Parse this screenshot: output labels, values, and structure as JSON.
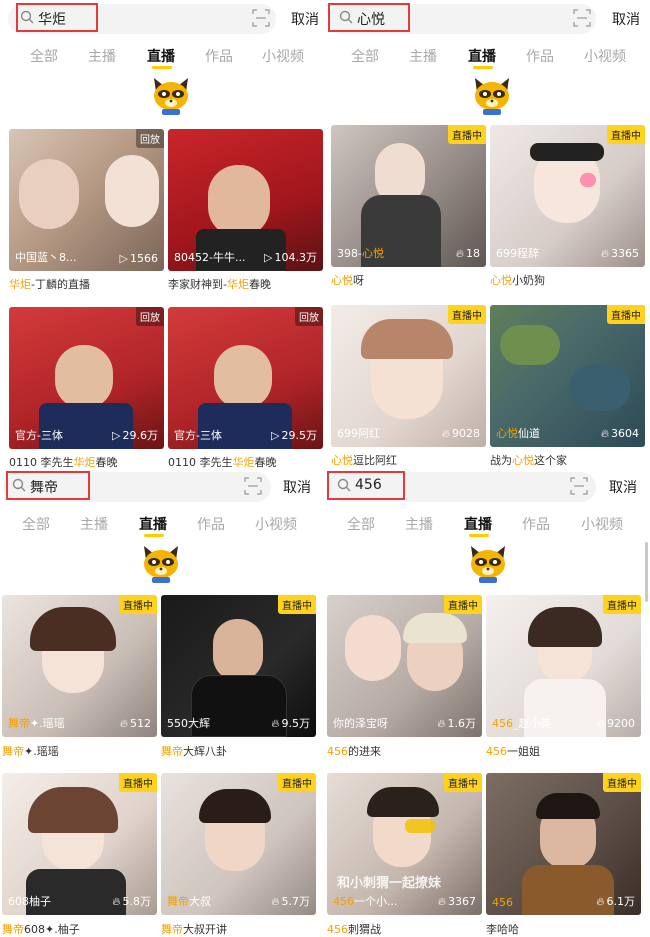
{
  "colors": {
    "accent": "#ffcc00",
    "highlight": "#f5a100",
    "search_outline": "#e23b3b"
  },
  "cancel_label": "取消",
  "tabs": [
    "全部",
    "主播",
    "直播",
    "作品",
    "小视频"
  ],
  "active_tab": "直播",
  "panels": [
    {
      "query": "华炬",
      "cards": [
        {
          "badge": "回放",
          "badge_type": "replay",
          "left": "中国蓝丶8...",
          "right": "1566",
          "right_icon": "play-icon",
          "cap_hl": "华炬",
          "cap_pre": "",
          "cap_post": "-丁麟的直播"
        },
        {
          "badge": "",
          "badge_type": "",
          "left": "80452-牛牛...",
          "right": "104.3万",
          "right_icon": "play-icon",
          "cap_pre": "李家财神到-",
          "cap_hl": "华炬",
          "cap_post": "春晚"
        },
        {
          "badge": "回放",
          "badge_type": "replay",
          "left": "官方-三体",
          "right": "29.6万",
          "right_icon": "play-icon",
          "cap_pre": "0110 李先生",
          "cap_hl": "华炬",
          "cap_post": "春晚"
        },
        {
          "badge": "回放",
          "badge_type": "replay",
          "left": "官方-三体",
          "right": "29.5万",
          "right_icon": "play-icon",
          "cap_pre": "0110 李先生",
          "cap_hl": "华炬",
          "cap_post": "春晚"
        }
      ]
    },
    {
      "query": "心悦",
      "cards": [
        {
          "badge": "直播中",
          "badge_type": "live",
          "left_pre": "398-",
          "left_hl": "心悦",
          "right": "18",
          "right_icon": "flame-icon",
          "cap_pre": "",
          "cap_hl": "心悦",
          "cap_post": "呀"
        },
        {
          "badge": "直播中",
          "badge_type": "live",
          "left_pre": "699程辞",
          "left_hl": "",
          "right": "3365",
          "right_icon": "flame-icon",
          "cap_pre": "",
          "cap_hl": "心悦",
          "cap_post": "小奶狗"
        },
        {
          "badge": "直播中",
          "badge_type": "live",
          "left_pre": "699阿红",
          "left_hl": "",
          "right": "9028",
          "right_icon": "flame-icon",
          "cap_pre": "",
          "cap_hl": "心悦",
          "cap_post": "逗比阿红"
        },
        {
          "badge": "直播中",
          "badge_type": "live",
          "left_pre": "",
          "left_hl": "心悦",
          "left_post": "仙道",
          "right": "3604",
          "right_icon": "flame-icon",
          "cap_pre": "战为",
          "cap_hl": "心悦",
          "cap_post": "这个家"
        }
      ]
    },
    {
      "query": "舞帝",
      "cards": [
        {
          "badge": "直播中",
          "badge_type": "live",
          "left_pre": "",
          "left_hl": "舞帝",
          "left_post": "✦.瑶瑶",
          "right": "512",
          "right_icon": "flame-icon",
          "cap_pre": "",
          "cap_hl": "舞帝",
          "cap_post": "✦.瑶瑶"
        },
        {
          "badge": "直播中",
          "badge_type": "live",
          "left_pre": "550大辉",
          "left_hl": "",
          "right": "9.5万",
          "right_icon": "flame-icon",
          "cap_pre": "",
          "cap_hl": "舞帝",
          "cap_post": "大辉八卦"
        },
        {
          "badge": "直播中",
          "badge_type": "live",
          "left_pre": "608柚子",
          "left_hl": "",
          "right": "5.8万",
          "right_icon": "flame-icon",
          "cap_pre": "",
          "cap_hl": "舞帝",
          "cap_post": "608✦.柚子"
        },
        {
          "badge": "直播中",
          "badge_type": "live",
          "left_pre": "",
          "left_hl": "舞帝",
          "left_post": "大叔",
          "right": "5.7万",
          "right_icon": "flame-icon",
          "cap_pre": "",
          "cap_hl": "舞帝",
          "cap_post": "大叔开讲"
        }
      ]
    },
    {
      "query": "456",
      "cards": [
        {
          "badge": "直播中",
          "badge_type": "live",
          "left_pre": "你的泽宝呀",
          "left_hl": "",
          "right": "1.6万",
          "right_icon": "flame-icon",
          "cap_pre": "",
          "cap_hl": "456",
          "cap_post": "的进来"
        },
        {
          "badge": "直播中",
          "badge_type": "live",
          "left_pre": "",
          "left_hl": "456",
          "left_post": "_赵小美",
          "right": "9200",
          "right_icon": "flame-icon",
          "cap_pre": "",
          "cap_hl": "456",
          "cap_post": "一姐姐"
        },
        {
          "badge": "直播中",
          "badge_type": "live",
          "left_pre": "",
          "left_hl": "456",
          "left_post": "一个小...",
          "right": "3367",
          "right_icon": "flame-icon",
          "cap_pre": "",
          "cap_hl": "456",
          "cap_post": "刺猬战",
          "overlay_text": "和小刺猬一起撩妹"
        },
        {
          "badge": "直播中",
          "badge_type": "live",
          "left_pre": "",
          "left_hl": "456",
          "left_post": "",
          "right": "6.1万",
          "right_icon": "flame-icon",
          "cap_pre": "李哈哈",
          "cap_hl": "",
          "cap_post": ""
        }
      ]
    }
  ]
}
